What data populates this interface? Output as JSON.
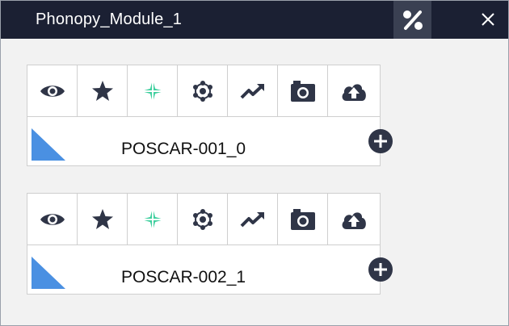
{
  "window": {
    "title": "Phonopy_Module_1",
    "percent_icon": "percent-icon",
    "close_icon": "close-icon"
  },
  "toolbar_icons": [
    "eye-icon",
    "star-icon",
    "compass-icon",
    "molecule-icon",
    "trend-up-icon",
    "camera-icon",
    "cloud-upload-icon"
  ],
  "colors": {
    "titlebar": "#1b2033",
    "accent_green": "#3ecf9e",
    "triangle_blue": "#4a90e2",
    "icon_dark": "#2f3547"
  },
  "cards": [
    {
      "filename": "POSCAR-001_0"
    },
    {
      "filename": "POSCAR-002_1"
    }
  ],
  "add_icon": "plus-circle-icon"
}
